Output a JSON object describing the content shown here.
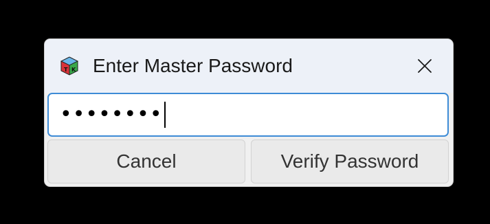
{
  "dialog": {
    "title": "Enter Master Password",
    "icon": "tk-cube-icon",
    "close_icon": "close-icon"
  },
  "password_field": {
    "value": "••••••••",
    "masked": true
  },
  "buttons": {
    "cancel_label": "Cancel",
    "verify_label": "Verify Password"
  },
  "colors": {
    "background": "#000000",
    "dialog_bg": "#f0f0f0",
    "titlebar_bg": "#edf1f8",
    "focus_border": "#3d8bd6"
  }
}
